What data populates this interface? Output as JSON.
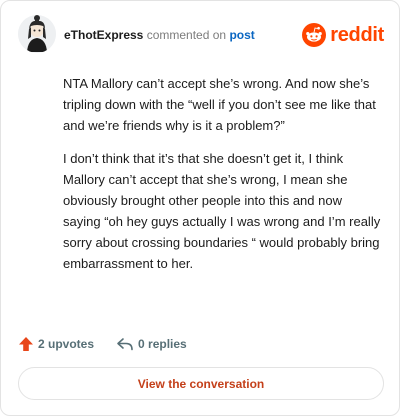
{
  "header": {
    "username": "eThotExpress",
    "action": "commented on",
    "target": "post",
    "brand": "reddit"
  },
  "comment": {
    "paragraphs": [
      "NTA Mallory can’t accept she’s wrong. And now she’s tripling down with the “well if you don’t see me like that and we’re friends why is it a problem?”",
      "I don’t think that it’s that she doesn’t get it, I think Mallory can’t accept that she’s wrong, I mean she obviously brought other people into this and now saying “oh hey guys actually I was wrong and I’m really sorry about crossing boundaries “ would probably bring embarrassment to her."
    ]
  },
  "stats": {
    "upvotes": "2 upvotes",
    "replies": "0 replies"
  },
  "cta": {
    "label": "View the conversation"
  },
  "colors": {
    "brand": "#ff4500",
    "link": "#0a66c2",
    "cta_text": "#c4401a",
    "muted": "#576f76"
  }
}
